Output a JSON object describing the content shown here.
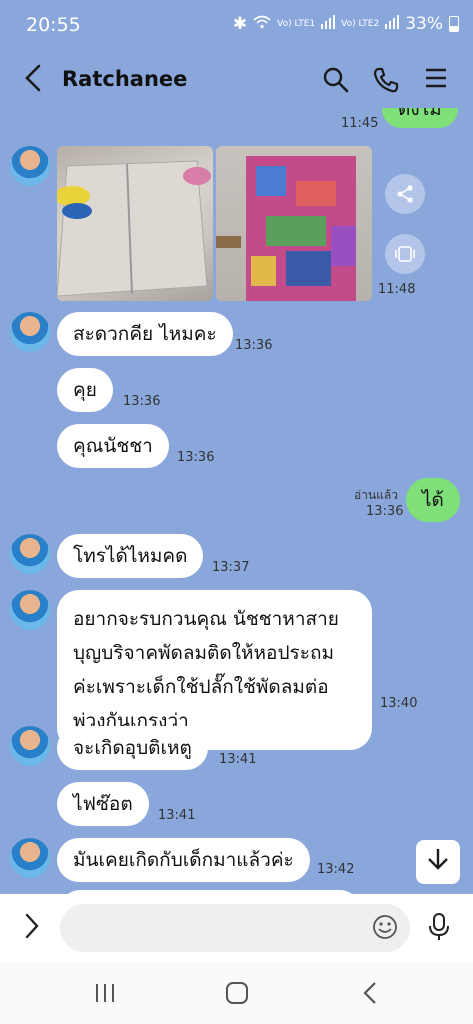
{
  "status": {
    "time": "20:55",
    "net1": "Vo) LTE1",
    "net2": "Vo) LTE2",
    "battery": "33%"
  },
  "header": {
    "contact": "Ratchanee"
  },
  "messages": {
    "prev_time": "11:45",
    "prev_text": "ดังไม",
    "photos_time": "11:48",
    "m1": "สะดวกคีย ไหมคะ",
    "m1_time": "13:36",
    "m2": "คุย",
    "m2_time": "13:36",
    "m3": "คุณนัชชา",
    "m3_time": "13:36",
    "mine_read": "อ่านแล้ว",
    "mine_time": "13:36",
    "mine": "ได้",
    "m4": "โทรได้ไหมคด",
    "m4_time": "13:37",
    "m5": "อยากจะรบกวนคุณ  นัชชาหาสาย บุญบริจาคพัดลมติดให้หอประถม ค่ะเพราะเด็กใช้ปลั๊กใช้พัดลมต่อ พ่วงกันเกรงว่า",
    "m5_time": "13:40",
    "m6": "จะเกิดอุบติเหตู",
    "m6_time": "13:41",
    "m7": "ไฟซ๊อต",
    "m7_time": "13:41",
    "m8": "มันเคยเกิดกับเด็กมาแล้วค่ะ",
    "m8_time": "13:42"
  },
  "input": {
    "placeholder": ""
  },
  "colors": {
    "background": "#8aa7dc",
    "mine": "#7fe07a",
    "other": "#ffffff"
  }
}
